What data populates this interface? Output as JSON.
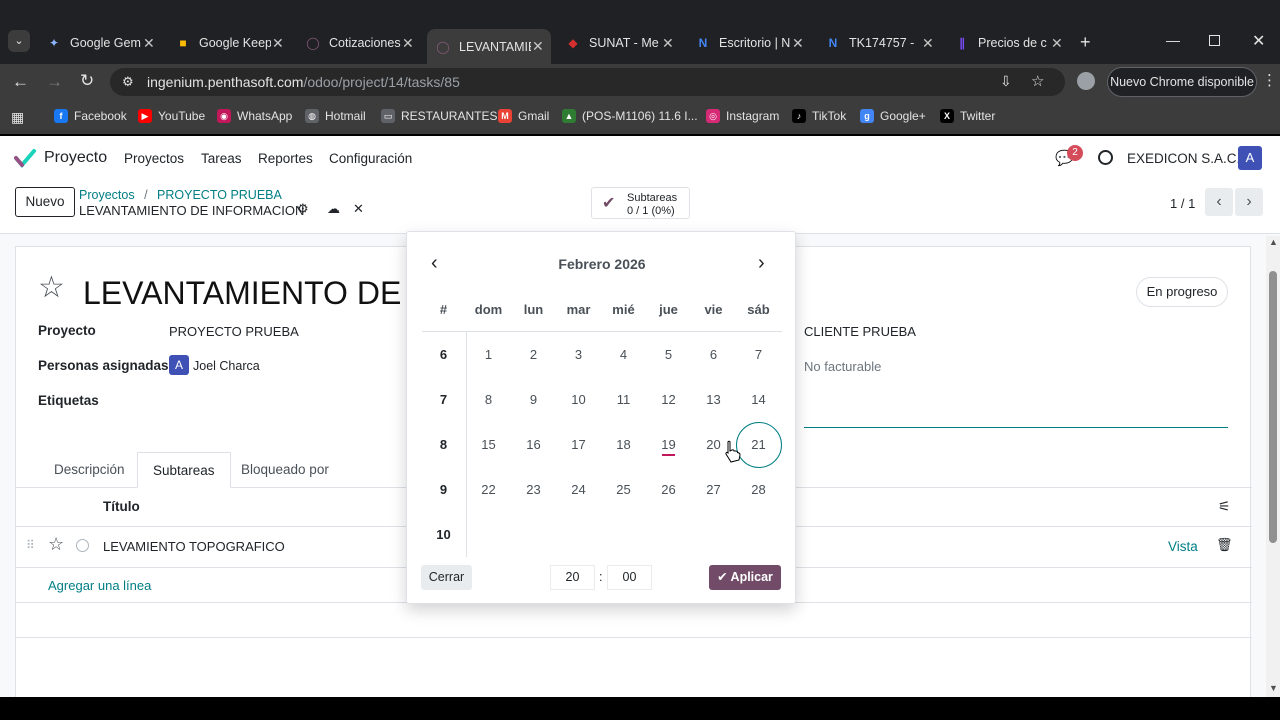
{
  "browser": {
    "tabs": [
      {
        "title": "Google Gem",
        "icon": "gemini-icon",
        "color": "#8ab4f8"
      },
      {
        "title": "Google Keep",
        "icon": "keep-icon",
        "color": "#fbbc04"
      },
      {
        "title": "Cotizaciones",
        "icon": "odoo-icon",
        "color": "#875a7b"
      },
      {
        "title": "LEVANTAMIE",
        "icon": "odoo-icon",
        "color": "#875a7b"
      },
      {
        "title": "SUNAT - Me",
        "icon": "sunat-icon",
        "color": "#d32f2f"
      },
      {
        "title": "Escritorio | N",
        "icon": "notion-icon",
        "color": "#4285f4"
      },
      {
        "title": "TK174757 - ",
        "icon": "notion-icon",
        "color": "#4285f4"
      },
      {
        "title": "Precios de c",
        "icon": "precios-icon",
        "color": "#7c4dff"
      }
    ],
    "url_host": "ingenium.penthasoft.com",
    "url_path": "/odoo/project/14/tasks/85",
    "update_label": "Nuevo Chrome disponible",
    "bookmarks": [
      {
        "label": "Facebook",
        "icon": "facebook-icon",
        "color": "#1877f2"
      },
      {
        "label": "YouTube",
        "icon": "youtube-icon",
        "color": "#ff0000"
      },
      {
        "label": "WhatsApp",
        "icon": "whatsapp-icon",
        "color": "#c2185b"
      },
      {
        "label": "Hotmail",
        "icon": "globe-icon",
        "color": "#5f6368"
      },
      {
        "label": "RESTAURANTES",
        "icon": "folder-icon",
        "color": "#5f6368"
      },
      {
        "label": "Gmail",
        "icon": "gmail-icon",
        "color": "#ea4335"
      },
      {
        "label": "(POS-M1106) 11.6 I...",
        "icon": "pos-icon",
        "color": "#2e7d32"
      },
      {
        "label": "Instagram",
        "icon": "instagram-icon",
        "color": "#d62976"
      },
      {
        "label": "TikTok",
        "icon": "tiktok-icon",
        "color": "#000000"
      },
      {
        "label": "Google+",
        "icon": "googleplus-icon",
        "color": "#4285f4"
      },
      {
        "label": "Twitter",
        "icon": "x-icon",
        "color": "#000000"
      }
    ]
  },
  "app": {
    "brand": "Proyecto",
    "menu": [
      "Proyectos",
      "Tareas",
      "Reportes",
      "Configuración"
    ],
    "company": "EXEDICON S.A.C.",
    "avatar_letter": "A",
    "notif_count": "2",
    "new_button": "Nuevo",
    "breadcrumb": [
      "Proyectos",
      "PROYECTO PRUEBA"
    ],
    "record_name": "LEVANTAMIENTO DE INFORMACION",
    "subtasks_label": "Subtareas",
    "subtasks_value": "0 / 1 (0%)",
    "pager": "1 / 1"
  },
  "task": {
    "title": "LEVANTAMIENTO DE IN",
    "stage": "En progreso",
    "fields": {
      "project_label": "Proyecto",
      "project_value": "PROYECTO PRUEBA",
      "assignees_label": "Personas asignadas",
      "assignee_avatar": "A",
      "assignee_name": "Joel Charca",
      "tags_label": "Etiquetas",
      "customer_value": "CLIENTE PRUEBA",
      "billing_value": "No facturable"
    },
    "tabs": [
      "Descripción",
      "Subtareas",
      "Bloqueado por"
    ],
    "list": {
      "column_title": "Título",
      "rows": [
        {
          "name": "LEVAMIENTO TOPOGRAFICO",
          "action": "Vista"
        }
      ],
      "add_line": "Agregar una línea"
    }
  },
  "datepicker": {
    "month_label": "Febrero 2026",
    "week_header": "#",
    "weekdays": [
      "dom",
      "lun",
      "mar",
      "mié",
      "jue",
      "vie",
      "sáb"
    ],
    "weeks": [
      {
        "num": "6",
        "days": [
          "1",
          "2",
          "3",
          "4",
          "5",
          "6",
          "7"
        ]
      },
      {
        "num": "7",
        "days": [
          "8",
          "9",
          "10",
          "11",
          "12",
          "13",
          "14"
        ]
      },
      {
        "num": "8",
        "days": [
          "15",
          "16",
          "17",
          "18",
          "19",
          "20",
          "21"
        ]
      },
      {
        "num": "9",
        "days": [
          "22",
          "23",
          "24",
          "25",
          "26",
          "27",
          "28"
        ]
      },
      {
        "num": "10",
        "days": []
      }
    ],
    "today": "19",
    "selected": "21",
    "close_label": "Cerrar",
    "hour": "20",
    "minute": "00",
    "apply_label": "Aplicar"
  },
  "colors": {
    "brand": "#714b67",
    "link": "#017e84",
    "today_mark": "#c2185b",
    "selected_ring": "#017e84"
  }
}
